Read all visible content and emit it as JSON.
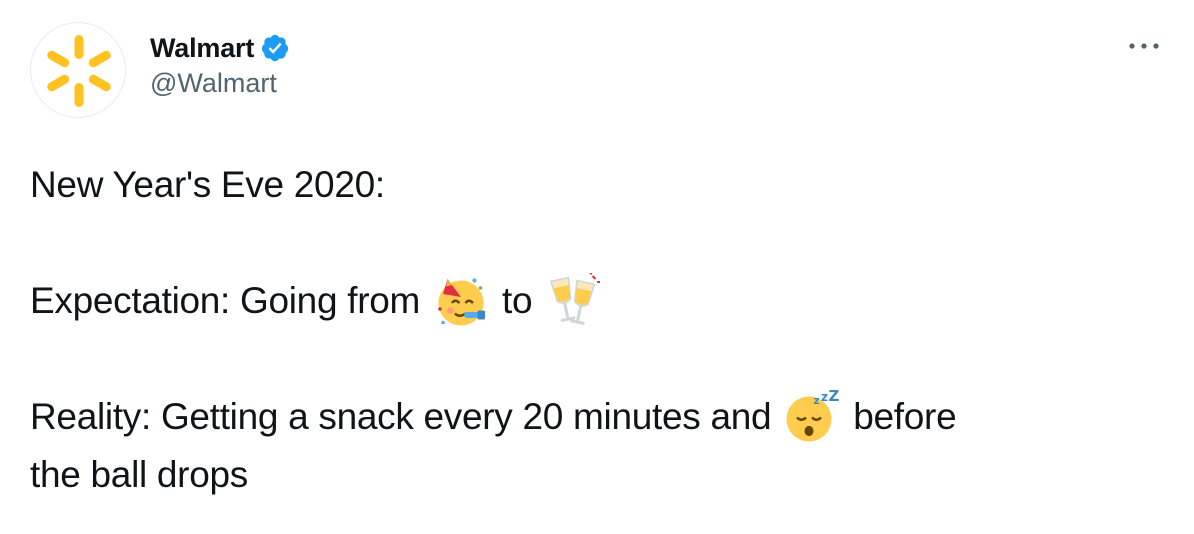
{
  "author": {
    "display_name": "Walmart",
    "handle": "@Walmart",
    "verified": true,
    "avatar_icon": "walmart-spark-logo",
    "brand_color": "#FFC220"
  },
  "menu": {
    "icon": "more-horizontal-icon",
    "label": "..."
  },
  "tweet": {
    "line1": "New Year's Eve 2020:",
    "line2_prefix": "Expectation: Going from ",
    "line2_emoji1": "partying-face",
    "line2_mid": " to ",
    "line2_emoji2": "clinking-glasses",
    "line3_prefix": "Reality: Getting a snack every 20 minutes and ",
    "line3_emoji": "sleeping-face",
    "line3_suffix": " before",
    "line4": "the ball drops"
  },
  "colors": {
    "text": "#0f1419",
    "secondary_text": "#536471",
    "verified_blue": "#1d9bf0",
    "emoji_yellow": "#FFCC4D"
  }
}
